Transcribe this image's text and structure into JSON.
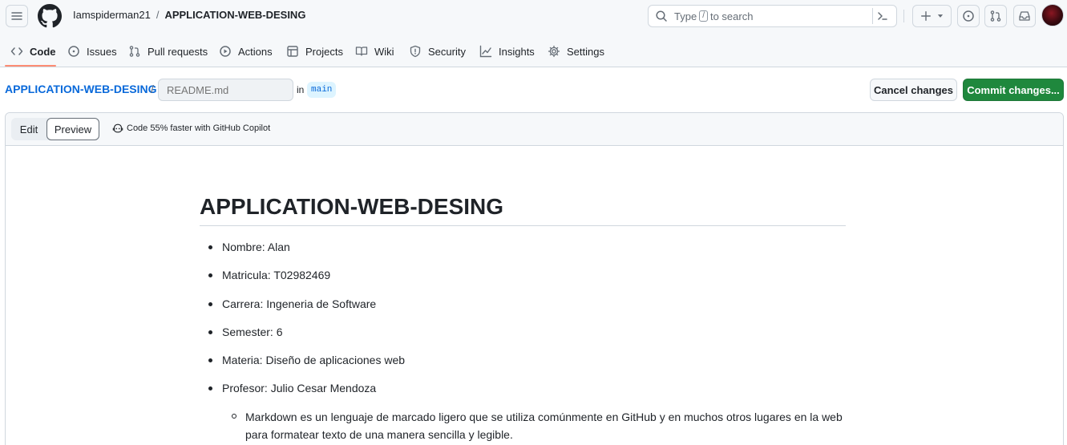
{
  "header": {
    "owner": "Iamspiderman21",
    "separator": "/",
    "repo": "APPLICATION-WEB-DESING",
    "search": {
      "prefix": "Type",
      "key": "/",
      "suffix": "to search"
    }
  },
  "nav": {
    "tabs": [
      {
        "label": "Code",
        "icon": "code-icon"
      },
      {
        "label": "Issues",
        "icon": "issue-opened-icon"
      },
      {
        "label": "Pull requests",
        "icon": "git-pull-request-icon"
      },
      {
        "label": "Actions",
        "icon": "play-icon"
      },
      {
        "label": "Projects",
        "icon": "table-icon"
      },
      {
        "label": "Wiki",
        "icon": "book-icon"
      },
      {
        "label": "Security",
        "icon": "shield-icon"
      },
      {
        "label": "Insights",
        "icon": "graph-icon"
      },
      {
        "label": "Settings",
        "icon": "gear-icon"
      }
    ]
  },
  "editbar": {
    "repo_link": "APPLICATION-WEB-DESING",
    "slash": "/",
    "filename_placeholder": "README.md",
    "in_label": "in",
    "branch": "main",
    "cancel_label": "Cancel changes",
    "commit_label": "Commit changes..."
  },
  "editor": {
    "edit_tab": "Edit",
    "preview_tab": "Preview",
    "copilot_text": "Code 55% faster with GitHub Copilot"
  },
  "preview": {
    "title": "APPLICATION-WEB-DESING",
    "items": [
      "Nombre: Alan",
      "Matricula: T02982469",
      "Carrera: Ingeneria de Software",
      "Semester: 6",
      "Materia: Diseño de aplicaciones web",
      "Profesor: Julio Cesar Mendoza"
    ],
    "sub_items": [
      "Markdown es un lenguaje de marcado ligero que se utiliza comúnmente en GitHub y en muchos otros lugares en la web para formatear texto de una manera sencilla y legible."
    ]
  },
  "colors": {
    "accent_link": "#0969da",
    "commit_green": "#1f883d",
    "tab_underline": "#fd8c73"
  }
}
